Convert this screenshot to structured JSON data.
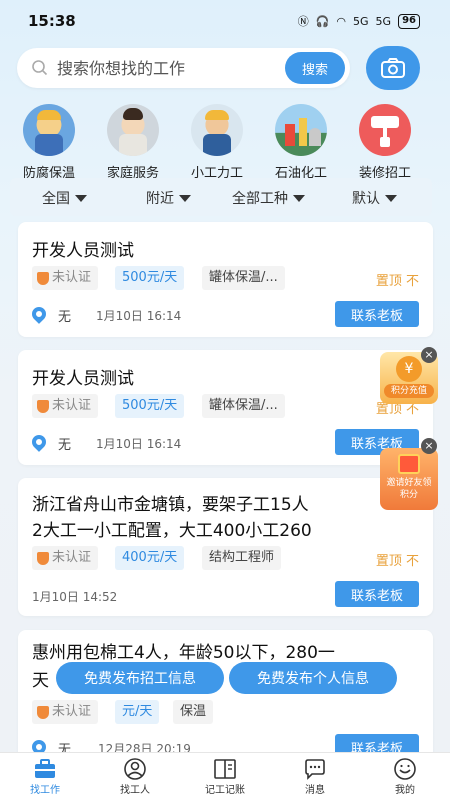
{
  "status_bar": {
    "time": "15:38",
    "signal_1": "5G",
    "signal_2": "5G",
    "battery": "96"
  },
  "search": {
    "placeholder": "搜索你想找的工作",
    "button_label": "搜索"
  },
  "categories": [
    {
      "label": "防腐保温",
      "icon": "anticorrosion-worker-icon"
    },
    {
      "label": "家庭服务",
      "icon": "home-service-worker-icon"
    },
    {
      "label": "小工力工",
      "icon": "laborer-icon"
    },
    {
      "label": "石油化工",
      "icon": "petrochemical-plant-icon"
    },
    {
      "label": "装修招工",
      "icon": "paint-roller-icon"
    }
  ],
  "filters": [
    {
      "label": "全国"
    },
    {
      "label": "附近"
    },
    {
      "label": "全部工种"
    },
    {
      "label": "默认"
    }
  ],
  "jobs": [
    {
      "title": "开发人员测试",
      "auth": "未认证",
      "salary": "500元/天",
      "type": "罐体保温/...",
      "pinned": "置顶",
      "location": "无",
      "date": "1月10日 16:14",
      "contact": "联系老板"
    },
    {
      "title": "开发人员测试",
      "auth": "未认证",
      "salary": "500元/天",
      "type": "罐体保温/...",
      "pinned": "置顶",
      "location": "无",
      "date": "1月10日 16:14",
      "contact": "联系老板"
    },
    {
      "title_line1": "浙江省舟山市金塘镇，要架子工15人",
      "title_line2": "2大工一小工配置，大工400小工260",
      "auth": "未认证",
      "salary": "400元/天",
      "type": "结构工程师",
      "pinned": "置顶",
      "date": "1月10日 14:52",
      "contact": "联系老板"
    },
    {
      "title_line1": "惠州用包棉工4人，年龄50以下，280一",
      "title_line2": "天",
      "auth": "未认证",
      "salary": "元/天",
      "type": "保温",
      "location": "无",
      "date": "12月28日 20:19",
      "contact": "联系老板"
    }
  ],
  "promos": [
    {
      "label": "积分充值",
      "icon": "coin-purse-icon"
    },
    {
      "label": "邀请好友领积分",
      "icon": "gift-icon"
    }
  ],
  "cta": {
    "recruit": "免费发布招工信息",
    "personal": "免费发布个人信息"
  },
  "tabs": [
    {
      "label": "找工作",
      "active": true
    },
    {
      "label": "找工人",
      "active": false
    },
    {
      "label": "记工记账",
      "active": false
    },
    {
      "label": "消息",
      "active": false
    },
    {
      "label": "我的",
      "active": false
    }
  ],
  "colors": {
    "accent": "#3f98e9",
    "pinned": "#e8a13b",
    "auth_icon": "#f08a3a"
  }
}
